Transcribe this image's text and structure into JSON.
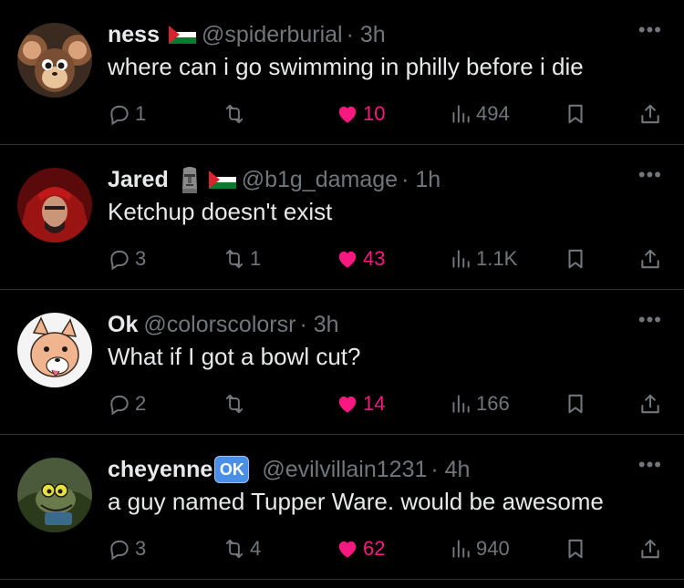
{
  "tweets": [
    {
      "name": "ness",
      "emoji": "palestine-flag",
      "handle": "@spiderburial",
      "time": "· 3h",
      "text": "where can i go swimming in philly before i die",
      "replies": "1",
      "reposts": "",
      "likes": "10",
      "views": "494"
    },
    {
      "name": "Jared",
      "emoji": "moai, palestine-flag",
      "handle": "@b1g_damage",
      "time": "· 1h",
      "text": "Ketchup doesn't exist",
      "replies": "3",
      "reposts": "1",
      "likes": "43",
      "views": "1.1K"
    },
    {
      "name": "Ok",
      "handle": "@colorscolorsr",
      "time": "· 3h",
      "text": "What if I got a bowl cut?",
      "replies": "2",
      "reposts": "",
      "likes": "14",
      "views": "166"
    },
    {
      "name": "cheyenne",
      "badge": "OK",
      "handle": "@evilvillain1231",
      "time": "· 4h",
      "text": "a guy named Tupper Ware. would be awesome",
      "replies": "3",
      "reposts": "4",
      "likes": "62",
      "views": "940"
    }
  ],
  "more_label": "•••",
  "colors": {
    "like": "#f91880",
    "muted": "#71767b",
    "text": "#e7e9ea",
    "divider": "#2f3336"
  }
}
